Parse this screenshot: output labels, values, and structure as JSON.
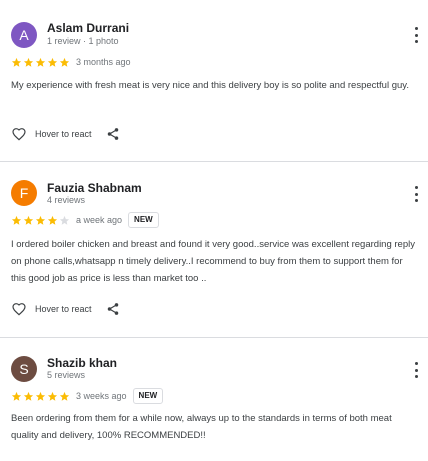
{
  "reviews": [
    {
      "avatar_letter": "A",
      "avatar_color": "#7e57c2",
      "name": "Aslam Durrani",
      "meta": "1 review · 1 photo",
      "rating": 5,
      "date": "3 months ago",
      "is_new": false,
      "text": "My experience with fresh meat is very nice and this delivery boy is so polite and respectful guy.",
      "react_label": "Hover to react"
    },
    {
      "avatar_letter": "F",
      "avatar_color": "#f57c00",
      "name": "Fauzia Shabnam",
      "meta": "4 reviews",
      "rating": 4,
      "date": "a week ago",
      "is_new": true,
      "new_label": "NEW",
      "text": "I ordered boiler chicken and breast and found it very good..service was excellent regarding reply on phone calls,whatsapp n timely delivery..I recommend to buy from them to support them for this good job as price is less than market too ..",
      "react_label": "Hover to react"
    },
    {
      "avatar_letter": "S",
      "avatar_color": "#6d4c41",
      "name": "Shazib khan",
      "meta": "5 reviews",
      "rating": 5,
      "date": "3 weeks ago",
      "is_new": true,
      "new_label": "NEW",
      "text": "Been ordering from them for a while now, always up to the standards in terms of both meat quality and delivery, 100% RECOMMENDED!!"
    }
  ],
  "icons": {
    "star": "star-icon",
    "more": "more-vert-icon",
    "react": "heart-outline-icon",
    "share": "share-icon"
  },
  "colors": {
    "star_filled": "#fbbc04",
    "star_empty": "#dadce0",
    "divider": "#dadce0"
  }
}
